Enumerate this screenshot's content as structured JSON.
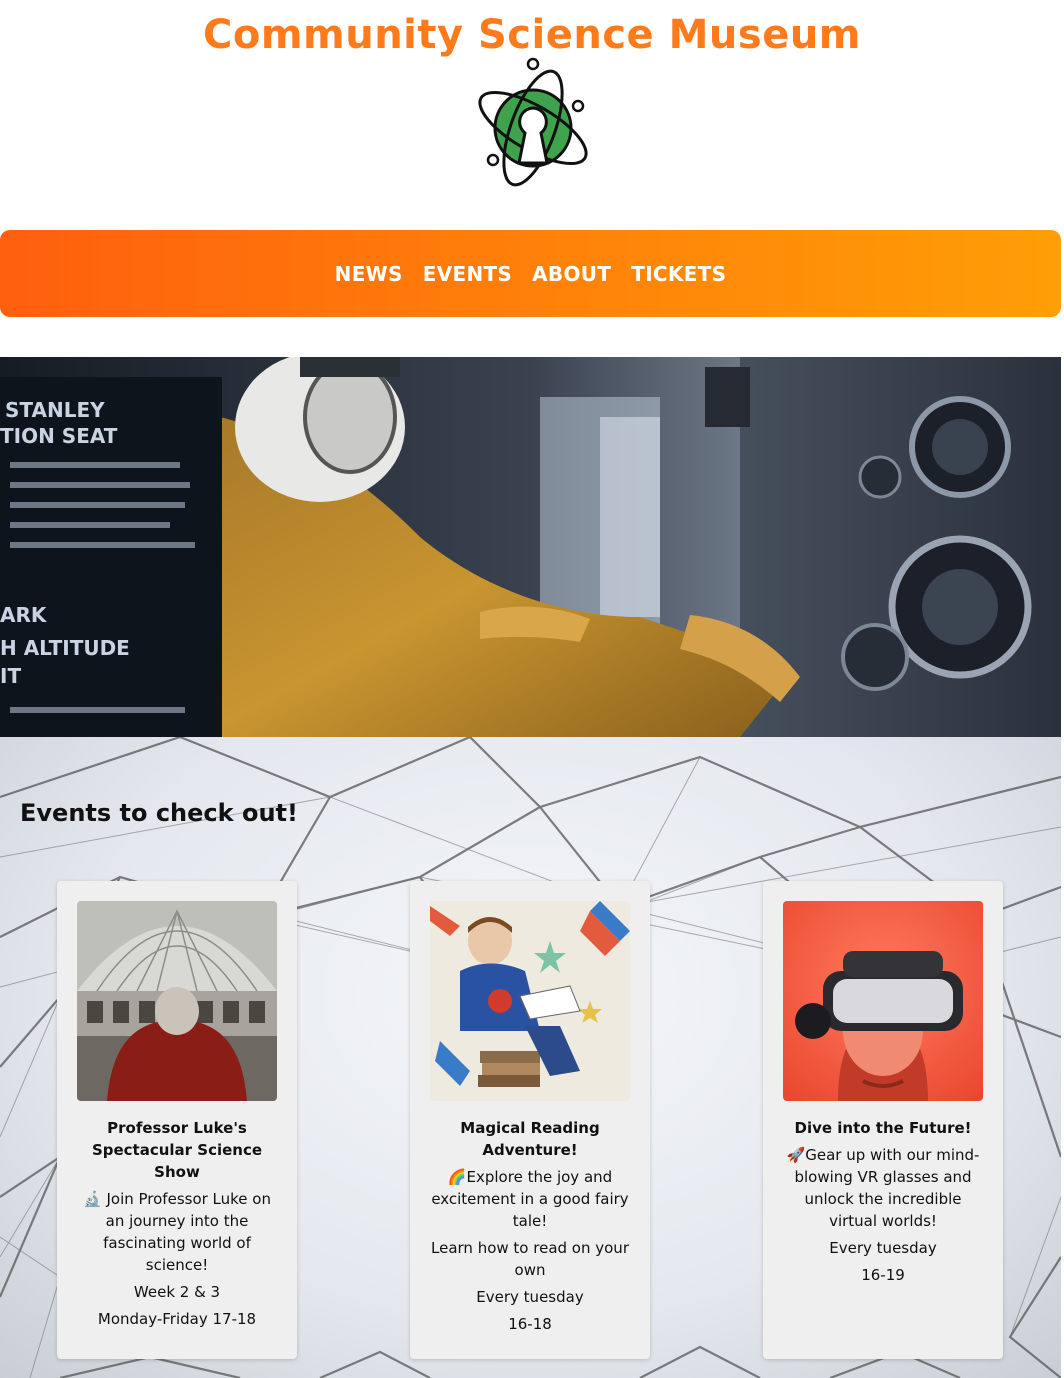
{
  "header": {
    "title": "Community Science Museum",
    "title_color": "#ff7a1a"
  },
  "nav": {
    "items": [
      "NEWS",
      "EVENTS",
      "ABOUT",
      "TICKETS"
    ],
    "gradient": [
      "#ff5f0e",
      "#ff9e05"
    ]
  },
  "hero": {
    "placard_lines": [
      "STANLEY",
      "TION SEAT",
      "ARK",
      "H ALTITUDE",
      "IT"
    ]
  },
  "events": {
    "heading": "Events to check out!",
    "cards": [
      {
        "title": "Professor Luke's Spectacular Science Show",
        "icon": "🔬",
        "description": "Join Professor Luke on an journey into the fascinating world of science!",
        "extra": "",
        "schedule": "Week 2 & 3",
        "time": "Monday-Friday 17-18"
      },
      {
        "title": "Magical Reading Adventure!",
        "icon": "🌈",
        "description": "Explore the joy and excitement in a good fairy tale!",
        "extra": "Learn how to read on your own",
        "schedule": "Every tuesday",
        "time": "16-18"
      },
      {
        "title": "Dive into the Future!",
        "icon": "🚀",
        "description": "Gear up with our mind-blowing VR glasses and unlock the incredible virtual worlds!",
        "extra": "",
        "schedule": "Every tuesday",
        "time": "16-19"
      }
    ]
  }
}
